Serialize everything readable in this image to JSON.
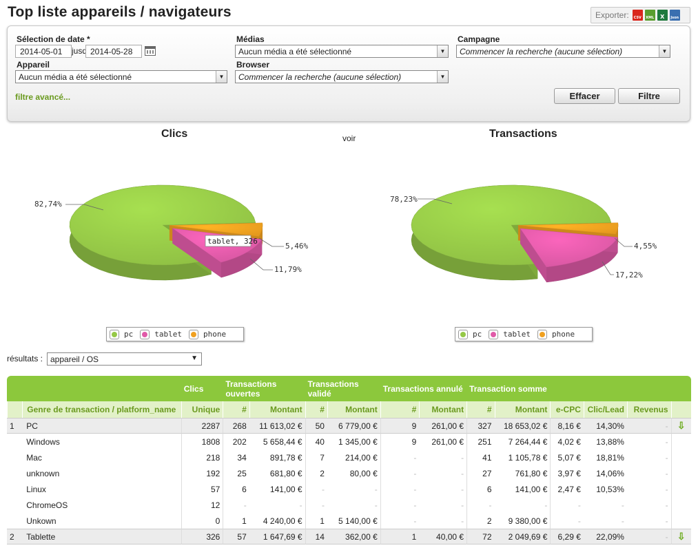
{
  "page": {
    "title": "Top liste appareils / navigateurs"
  },
  "export": {
    "label": "Exporter:",
    "icons": [
      "csv-icon",
      "xml-icon",
      "excel-icon",
      "json-icon"
    ],
    "csv": "CSV",
    "xml": "XML",
    "xls": "X",
    "json": "Json"
  },
  "filters": {
    "date_label": "Sélection de date *",
    "date_from": "2014-05-01",
    "date_between": "jusqu'à",
    "date_to": "2014-05-28",
    "medias_label": "Médias",
    "medias_value": "Aucun média a été sélectionné",
    "campagne_label": "Campagne",
    "campagne_value": "Commencer la recherche (aucune sélection)",
    "appareil_label": "Appareil",
    "appareil_value": "Aucun média a été sélectionné",
    "browser_label": "Browser",
    "browser_value": "Commencer la recherche (aucune sélection)",
    "advanced_link": "filtre avancé...",
    "clear_button": "Effacer",
    "filter_button": "Filtre"
  },
  "charts": {
    "voir": "voir",
    "tooltip": "tablet, 326"
  },
  "chart_data": [
    {
      "type": "pie",
      "title": "Clics",
      "categories": [
        "pc",
        "tablet",
        "phone"
      ],
      "values": [
        82.74,
        11.79,
        5.46
      ],
      "value_labels": [
        "82,74%",
        "11,79%",
        "5,46%"
      ],
      "colors": [
        "#95c847",
        "#e05aa8",
        "#f0a020"
      ],
      "legend": [
        "pc",
        "tablet",
        "phone"
      ],
      "legend_position": "bottom"
    },
    {
      "type": "pie",
      "title": "Transactions",
      "categories": [
        "pc",
        "tablet",
        "phone"
      ],
      "values": [
        78.23,
        17.22,
        4.55
      ],
      "value_labels": [
        "78,23%",
        "17,22%",
        "4,55%"
      ],
      "colors": [
        "#95c847",
        "#e05aa8",
        "#f0a020"
      ],
      "legend": [
        "pc",
        "tablet",
        "phone"
      ],
      "legend_position": "bottom"
    }
  ],
  "results": {
    "label": "résultats :",
    "value": "appareil / OS"
  },
  "table": {
    "group_headers": [
      "Clics",
      "Transactions ouvertes",
      "Transactions validé",
      "Transactions annulé",
      "Transaction somme"
    ],
    "columns": [
      "Genre de transaction / platform_name",
      "Unique",
      "#",
      "Montant",
      "#",
      "Montant",
      "#",
      "Montant",
      "#",
      "Montant",
      "e-CPC",
      "Clic/Lead",
      "Revenus"
    ],
    "rows": [
      {
        "group": true,
        "idx": "1",
        "name": "PC",
        "cells": [
          "2287",
          "268",
          "11 613,02 €",
          "50",
          "6 779,00 €",
          "9",
          "261,00 €",
          "327",
          "18 653,02 €",
          "8,16 €",
          "14,30%",
          "-"
        ]
      },
      {
        "group": false,
        "idx": "",
        "name": "Windows",
        "cells": [
          "1808",
          "202",
          "5 658,44 €",
          "40",
          "1 345,00 €",
          "9",
          "261,00 €",
          "251",
          "7 264,44 €",
          "4,02 €",
          "13,88%",
          "-"
        ]
      },
      {
        "group": false,
        "idx": "",
        "name": "Mac",
        "cells": [
          "218",
          "34",
          "891,78 €",
          "7",
          "214,00 €",
          "-",
          "-",
          "41",
          "1 105,78 €",
          "5,07 €",
          "18,81%",
          "-"
        ]
      },
      {
        "group": false,
        "idx": "",
        "name": "unknown",
        "cells": [
          "192",
          "25",
          "681,80 €",
          "2",
          "80,00 €",
          "-",
          "-",
          "27",
          "761,80 €",
          "3,97 €",
          "14,06%",
          "-"
        ]
      },
      {
        "group": false,
        "idx": "",
        "name": "Linux",
        "cells": [
          "57",
          "6",
          "141,00 €",
          "-",
          "-",
          "-",
          "-",
          "6",
          "141,00 €",
          "2,47 €",
          "10,53%",
          "-"
        ]
      },
      {
        "group": false,
        "idx": "",
        "name": "ChromeOS",
        "cells": [
          "12",
          "-",
          "-",
          "-",
          "-",
          "-",
          "-",
          "-",
          "-",
          "-",
          "-",
          "-"
        ]
      },
      {
        "group": false,
        "idx": "",
        "name": "Unkown",
        "cells": [
          "0",
          "1",
          "4 240,00 €",
          "1",
          "5 140,00 €",
          "-",
          "-",
          "2",
          "9 380,00 €",
          "-",
          "-",
          "-"
        ]
      },
      {
        "group": true,
        "idx": "2",
        "name": "Tablette",
        "cells": [
          "326",
          "57",
          "1 647,69 €",
          "14",
          "362,00 €",
          "1",
          "40,00 €",
          "72",
          "2 049,69 €",
          "6,29 €",
          "22,09%",
          "-"
        ]
      }
    ],
    "expand_icon": "arrow-down-icon"
  }
}
